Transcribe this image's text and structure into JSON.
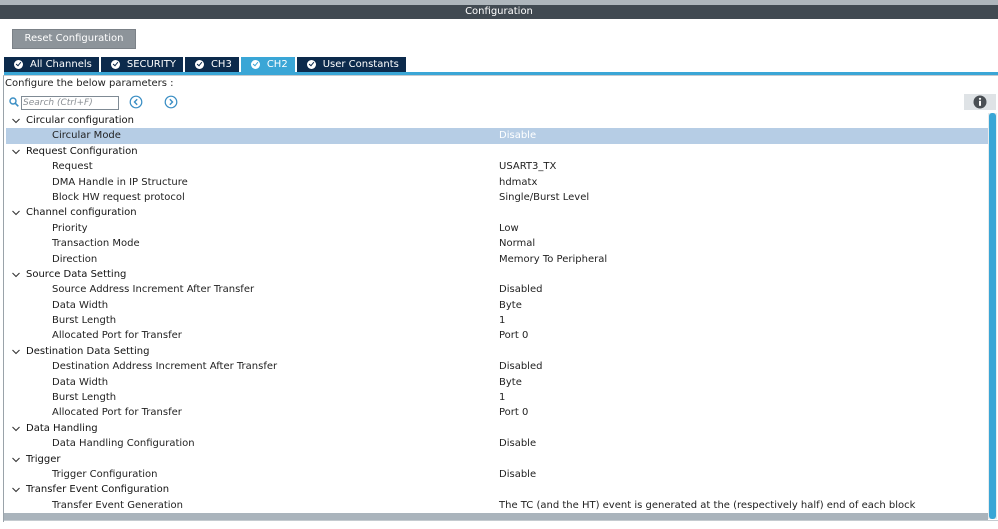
{
  "window": {
    "title": "Configuration"
  },
  "reset_button": {
    "label": "Reset Configuration"
  },
  "tabs": [
    {
      "label": "All Channels",
      "active": false
    },
    {
      "label": "SECURITY",
      "active": false
    },
    {
      "label": "CH3",
      "active": false
    },
    {
      "label": "CH2",
      "active": true
    },
    {
      "label": "User Constants",
      "active": false
    }
  ],
  "panel": {
    "hint": "Configure the below parameters :"
  },
  "search": {
    "placeholder": "Search (Ctrl+F)",
    "value": ""
  },
  "icons": {
    "search": "search-icon",
    "prev": "previous-circle-icon",
    "next": "next-circle-icon",
    "info": "info-icon",
    "expand": "chevron-down-icon",
    "tab_status": "check-circle-icon"
  },
  "colors": {
    "titlebar": "#414a52",
    "tab": "#0c2a4c",
    "tab_active": "#3aa6d6",
    "selected_row": "#b6cde5",
    "button": "#8d949a"
  },
  "tree": [
    {
      "type": "group",
      "label": "Circular configuration"
    },
    {
      "type": "param",
      "label": "Circular Mode",
      "value": "Disable",
      "selected": true
    },
    {
      "type": "group",
      "label": "Request Configuration"
    },
    {
      "type": "param",
      "label": "Request",
      "value": "USART3_TX"
    },
    {
      "type": "param",
      "label": "DMA Handle in IP Structure",
      "value": "hdmatx"
    },
    {
      "type": "param",
      "label": "Block HW request protocol",
      "value": "Single/Burst Level"
    },
    {
      "type": "group",
      "label": "Channel configuration"
    },
    {
      "type": "param",
      "label": "Priority",
      "value": "Low"
    },
    {
      "type": "param",
      "label": "Transaction Mode",
      "value": "Normal"
    },
    {
      "type": "param",
      "label": "Direction",
      "value": "Memory To Peripheral"
    },
    {
      "type": "group",
      "label": "Source Data Setting"
    },
    {
      "type": "param",
      "label": "Source Address Increment After Transfer",
      "value": "Disabled"
    },
    {
      "type": "param",
      "label": "Data Width",
      "value": "Byte"
    },
    {
      "type": "param",
      "label": "Burst Length",
      "value": "1"
    },
    {
      "type": "param",
      "label": "Allocated Port for Transfer",
      "value": "Port 0"
    },
    {
      "type": "group",
      "label": "Destination Data Setting"
    },
    {
      "type": "param",
      "label": "Destination Address Increment After Transfer",
      "value": "Disabled"
    },
    {
      "type": "param",
      "label": "Data Width",
      "value": "Byte"
    },
    {
      "type": "param",
      "label": "Burst Length",
      "value": "1"
    },
    {
      "type": "param",
      "label": "Allocated Port for Transfer",
      "value": "Port 0"
    },
    {
      "type": "group",
      "label": "Data Handling"
    },
    {
      "type": "param",
      "label": "Data Handling Configuration",
      "value": "Disable"
    },
    {
      "type": "group",
      "label": "Trigger"
    },
    {
      "type": "param",
      "label": "Trigger Configuration",
      "value": "Disable"
    },
    {
      "type": "group",
      "label": "Transfer Event Configuration"
    },
    {
      "type": "param",
      "label": "Transfer Event Generation",
      "value": "The TC (and the HT) event is generated at the (respectively half) end of each block"
    }
  ]
}
